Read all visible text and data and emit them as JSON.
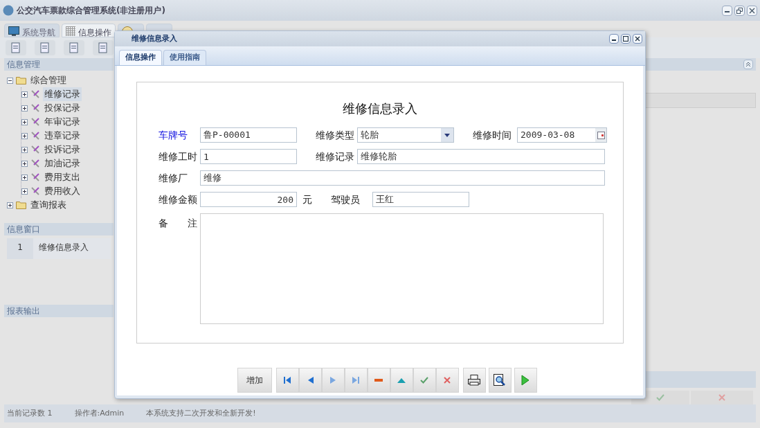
{
  "window": {
    "title": "公交汽车票款综合管理系统(非注册用户)"
  },
  "main_tabs": [
    {
      "label": "系统导航",
      "selected": false
    },
    {
      "label": "信息操作",
      "selected": true
    },
    {
      "selected": false
    },
    {
      "selected": false
    }
  ],
  "sidebar": {
    "tree_title": "信息管理",
    "tree": [
      {
        "label": "综合管理",
        "kind": "folder",
        "expanded": true,
        "selected": false,
        "children": [
          {
            "label": "维修记录",
            "kind": "tool",
            "expanded": false,
            "selected": true
          },
          {
            "label": "投保记录",
            "kind": "tool",
            "expanded": false,
            "selected": false
          },
          {
            "label": "年审记录",
            "kind": "tool",
            "expanded": false,
            "selected": false
          },
          {
            "label": "违章记录",
            "kind": "tool",
            "expanded": false,
            "selected": false
          },
          {
            "label": "投诉记录",
            "kind": "tool",
            "expanded": false,
            "selected": false
          },
          {
            "label": "加油记录",
            "kind": "tool",
            "expanded": false,
            "selected": false
          },
          {
            "label": "费用支出",
            "kind": "tool",
            "expanded": false,
            "selected": false
          },
          {
            "label": "费用收入",
            "kind": "tool",
            "expanded": false,
            "selected": false
          }
        ]
      },
      {
        "label": "查询报表",
        "kind": "folder",
        "expanded": false,
        "selected": false
      }
    ],
    "windows_title": "信息窗口",
    "windows": [
      {
        "index": "1",
        "label": "维修信息录入"
      }
    ],
    "report_title": "报表输出"
  },
  "status_bar": [
    "当前记录数 1",
    "操作者:Admin",
    "本系统支持二次开发和全新开发!"
  ],
  "dialog": {
    "title": "维修信息录入",
    "tabs": [
      {
        "label": "信息操作",
        "selected": true
      },
      {
        "label": "使用指南",
        "selected": false
      }
    ],
    "form_title": "维修信息录入",
    "rows": [
      [
        {
          "label": "车牌号",
          "highlighted": true,
          "kind": "text",
          "value": "鲁P-00001"
        },
        {
          "label": "维修类型",
          "highlighted": false,
          "kind": "select",
          "value": "轮胎"
        },
        {
          "label": "维修时间",
          "highlighted": false,
          "kind": "date",
          "value": "2009-03-08"
        }
      ],
      [
        {
          "label": "维修工时",
          "highlighted": false,
          "kind": "text",
          "value": "1"
        },
        {
          "label": "维修记录",
          "highlighted": false,
          "kind": "text",
          "value": "维修轮胎"
        }
      ],
      [
        {
          "label": "维修厂",
          "highlighted": false,
          "kind": "text",
          "value": "维修"
        }
      ],
      [
        {
          "label": "维修金额",
          "highlighted": false,
          "kind": "number",
          "value": "200",
          "unit": "元"
        },
        {
          "label": "驾驶员",
          "highlighted": false,
          "kind": "text",
          "value": "王红"
        }
      ]
    ],
    "remark": {
      "label": "备　　注"
    },
    "buttons": [
      {
        "kind": "text",
        "label": "增加"
      },
      {
        "kind": "first"
      },
      {
        "kind": "prev"
      },
      {
        "kind": "next"
      },
      {
        "kind": "last"
      },
      {
        "kind": "delete"
      },
      {
        "kind": "up"
      },
      {
        "kind": "save"
      },
      {
        "kind": "cancel"
      },
      {
        "kind": "print"
      },
      {
        "kind": "preview"
      },
      {
        "kind": "run"
      }
    ]
  }
}
